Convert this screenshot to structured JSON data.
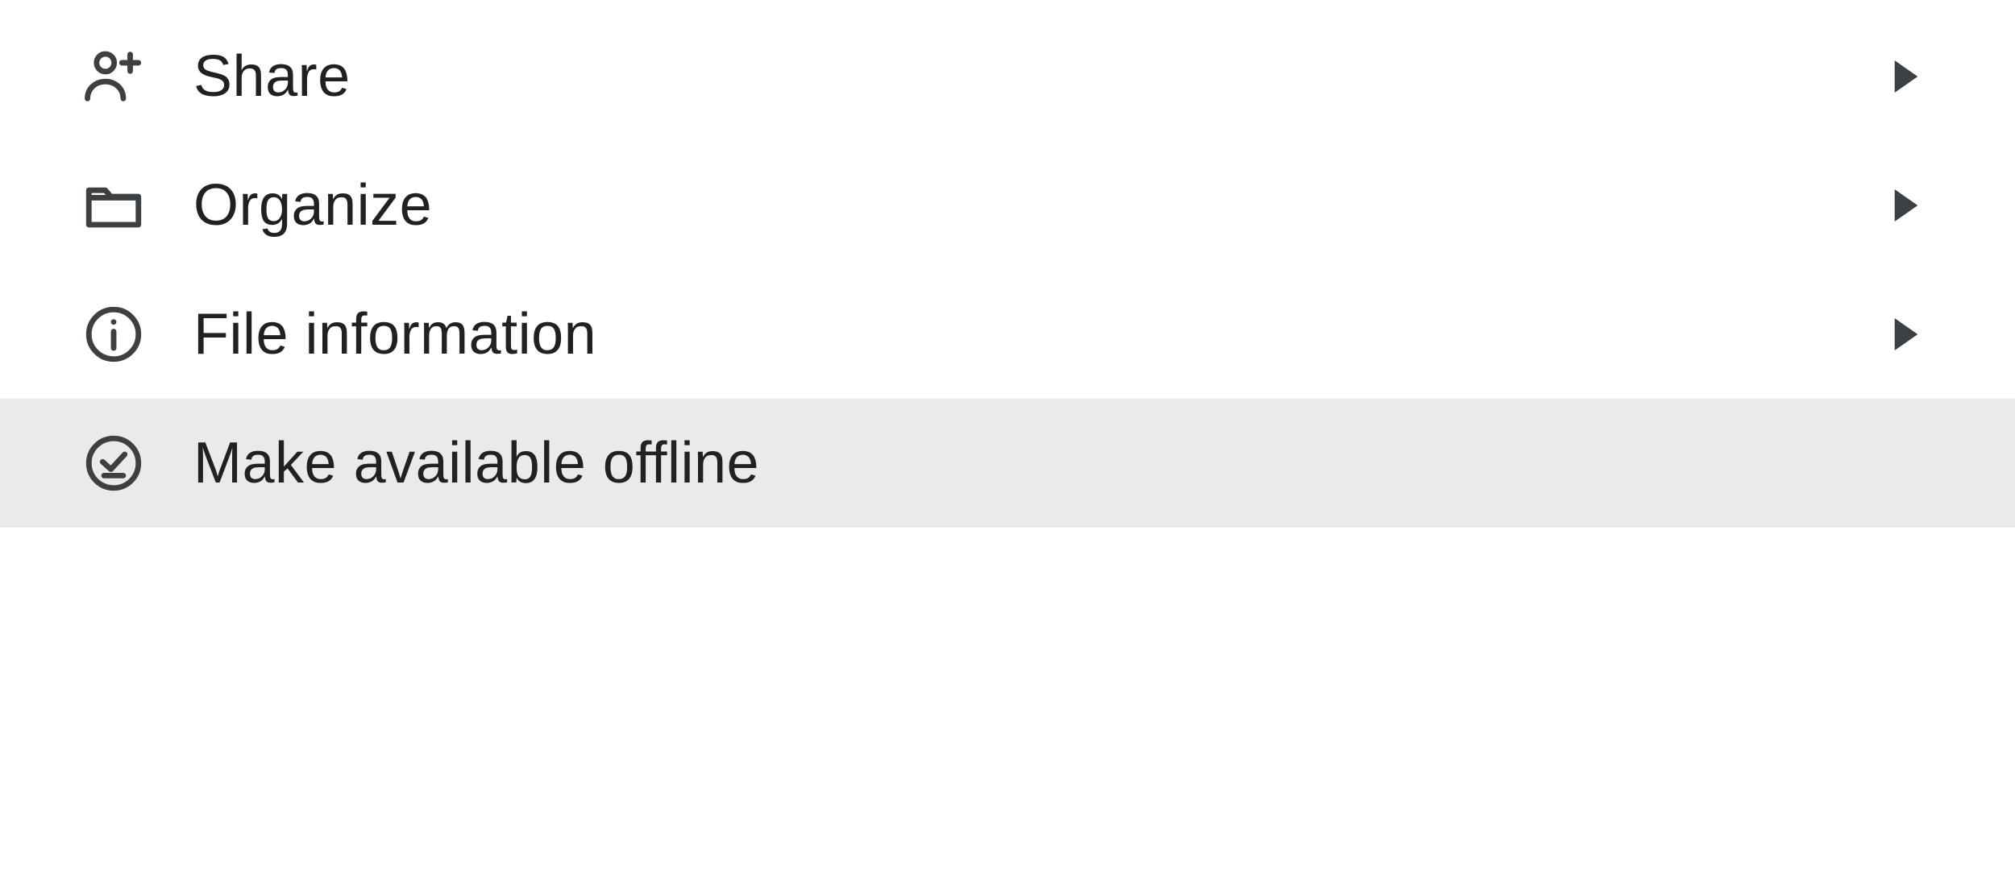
{
  "menu": {
    "items": [
      {
        "label": "Share"
      },
      {
        "label": "Organize"
      },
      {
        "label": "File information"
      },
      {
        "label": "Make available offline"
      }
    ]
  }
}
